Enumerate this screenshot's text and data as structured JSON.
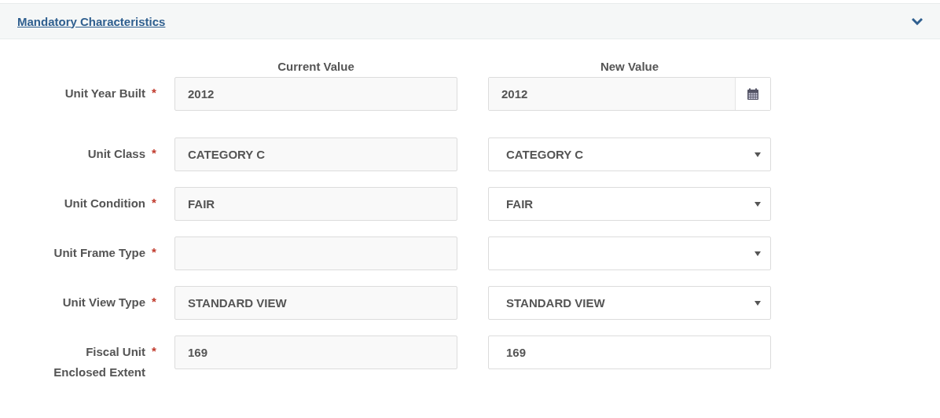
{
  "panel": {
    "title": "Mandatory Characteristics",
    "expanded": true
  },
  "columns": {
    "current": "Current Value",
    "new": "New Value"
  },
  "fields": [
    {
      "label": "Unit Year Built",
      "required": "*",
      "current": "2012",
      "new": "2012",
      "kind": "date"
    },
    {
      "label": "Unit Class",
      "required": "*",
      "current": "CATEGORY C",
      "new": "CATEGORY C",
      "kind": "select"
    },
    {
      "label": "Unit Condition",
      "required": "*",
      "current": "FAIR",
      "new": "FAIR",
      "kind": "select"
    },
    {
      "label": "Unit Frame Type",
      "required": "*",
      "kind": "select"
    },
    {
      "label": "Unit View Type",
      "required": "*",
      "current": "STANDARD VIEW",
      "new": "STANDARD VIEW",
      "kind": "select"
    },
    {
      "label": "Fiscal Unit Enclosed Extent",
      "required": "*",
      "current": "169",
      "new": "169",
      "kind": "text"
    }
  ]
}
